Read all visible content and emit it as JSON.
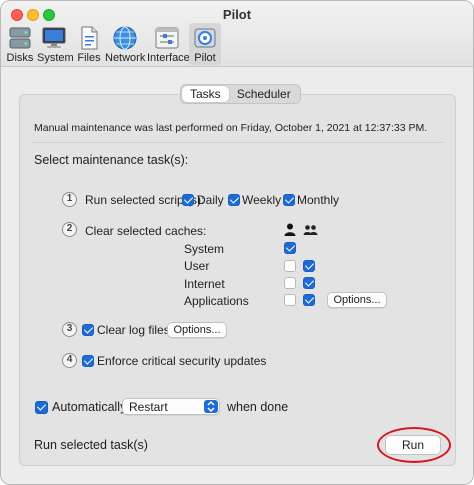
{
  "window": {
    "title": "Pilot"
  },
  "toolbar": {
    "items": [
      {
        "label": "Disks",
        "icon": "disks-icon"
      },
      {
        "label": "System",
        "icon": "system-icon"
      },
      {
        "label": "Files",
        "icon": "files-icon"
      },
      {
        "label": "Network",
        "icon": "network-icon"
      },
      {
        "label": "Interface",
        "icon": "interface-icon"
      },
      {
        "label": "Pilot",
        "icon": "pilot-icon",
        "selected": true
      }
    ]
  },
  "tabs": [
    {
      "label": "Tasks",
      "active": true
    },
    {
      "label": "Scheduler",
      "active": false
    }
  ],
  "status_text": "Manual maintenance was last performed on Friday, October 1, 2021 at 12:37:33 PM.",
  "section_title": "Select maintenance task(s):",
  "tasks": {
    "task1": {
      "number": "1",
      "label": "Run selected script(s):",
      "options": [
        {
          "label": "Daily",
          "checked": true
        },
        {
          "label": "Weekly",
          "checked": true
        },
        {
          "label": "Monthly",
          "checked": true
        }
      ]
    },
    "task2": {
      "number": "2",
      "label": "Clear selected caches:",
      "column_icons": [
        "single-user-icon",
        "multiple-users-icon"
      ],
      "caches": [
        {
          "label": "System",
          "user": true,
          "all_users": null
        },
        {
          "label": "User",
          "user": false,
          "all_users": true
        },
        {
          "label": "Internet",
          "user": false,
          "all_users": true
        },
        {
          "label": "Applications",
          "user": false,
          "all_users": true
        }
      ],
      "options_button": "Options..."
    },
    "task3": {
      "number": "3",
      "label": "Clear log files",
      "checked": true,
      "options_button": "Options..."
    },
    "task4": {
      "number": "4",
      "label": "Enforce critical security updates",
      "checked": true
    }
  },
  "automatically": {
    "checked": true,
    "label": "Automatically",
    "selected_action": "Restart",
    "suffix": "when done"
  },
  "footer": {
    "label": "Run selected task(s)",
    "run_button": "Run"
  },
  "colors": {
    "accent": "#1f6bd6",
    "highlight_ring": "#d8141c"
  }
}
